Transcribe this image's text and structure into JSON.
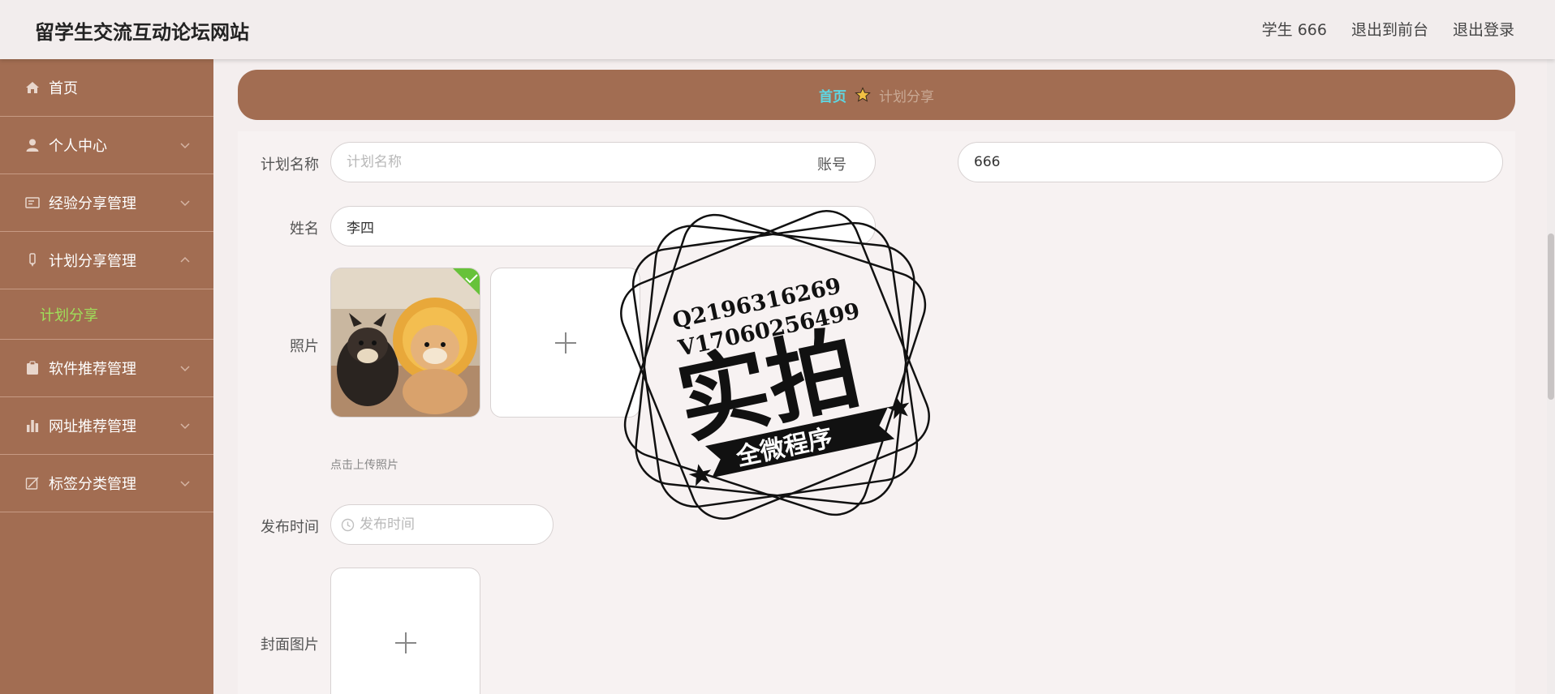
{
  "header": {
    "site_title": "留学生交流互动论坛网站",
    "user": "学生 666",
    "to_front": "退出到前台",
    "logout": "退出登录"
  },
  "sidebar": {
    "items": [
      {
        "label": "首页",
        "icon": "home-icon"
      },
      {
        "label": "个人中心",
        "icon": "user-icon"
      },
      {
        "label": "经验分享管理",
        "icon": "card-icon"
      },
      {
        "label": "计划分享管理",
        "icon": "pen-icon",
        "expanded": true
      },
      {
        "label": "软件推荐管理",
        "icon": "clipboard-icon"
      },
      {
        "label": "网址推荐管理",
        "icon": "bar-chart-icon"
      },
      {
        "label": "标签分类管理",
        "icon": "edit-icon"
      }
    ],
    "submenu_active": "计划分享",
    "active_color": "#9fe05a"
  },
  "breadcrumb": {
    "home": "首页",
    "current": "计划分享"
  },
  "form": {
    "plan_name_label": "计划名称",
    "plan_name_placeholder": "计划名称",
    "account_label": "账号",
    "account_value": "666",
    "name_label": "姓名",
    "name_value": "李四",
    "photo_label": "照片",
    "photo_hint": "点击上传照片",
    "publish_time_label": "发布时间",
    "publish_time_placeholder": "发布时间",
    "cover_label": "封面图片"
  },
  "watermark": {
    "line1": "Q2196316269",
    "line2": "V17060256499",
    "main": "实拍",
    "ribbon": "全微程序"
  },
  "colors": {
    "sidebar": "#a26d52",
    "breadcrumb_home": "#5ed7e3"
  }
}
